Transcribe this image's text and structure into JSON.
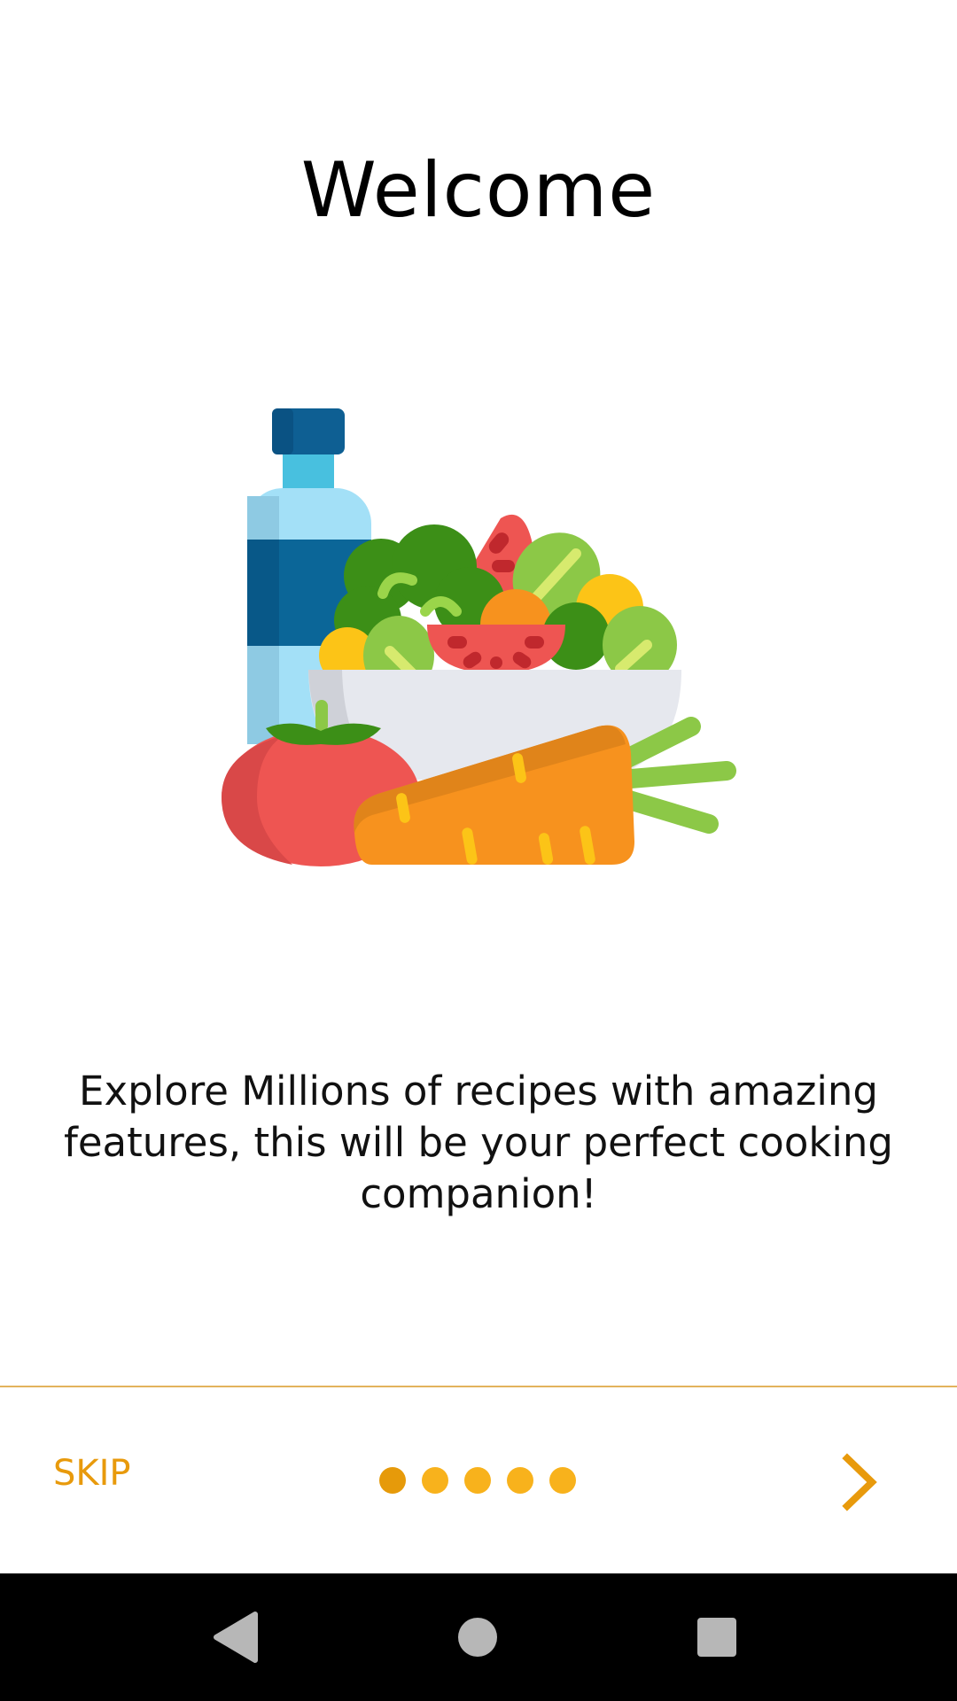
{
  "onboarding": {
    "title": "Welcome",
    "description": "Explore Millions of recipes with amazing features, this will be your perfect cooking companion!",
    "illustration_icon": "healthy-food-illustration",
    "page_count": 5,
    "current_page": 1
  },
  "footer": {
    "skip_label": "SKIP",
    "next_icon": "chevron-right-icon"
  },
  "colors": {
    "accent": "#e89a0c",
    "dot_inactive": "#f8b21c",
    "dot_active": "#e69a0a",
    "divider": "#e3b35c",
    "navbar": "#000000"
  },
  "system_nav": {
    "back_icon": "back-triangle-icon",
    "home_icon": "home-circle-icon",
    "recents_icon": "recents-square-icon"
  }
}
